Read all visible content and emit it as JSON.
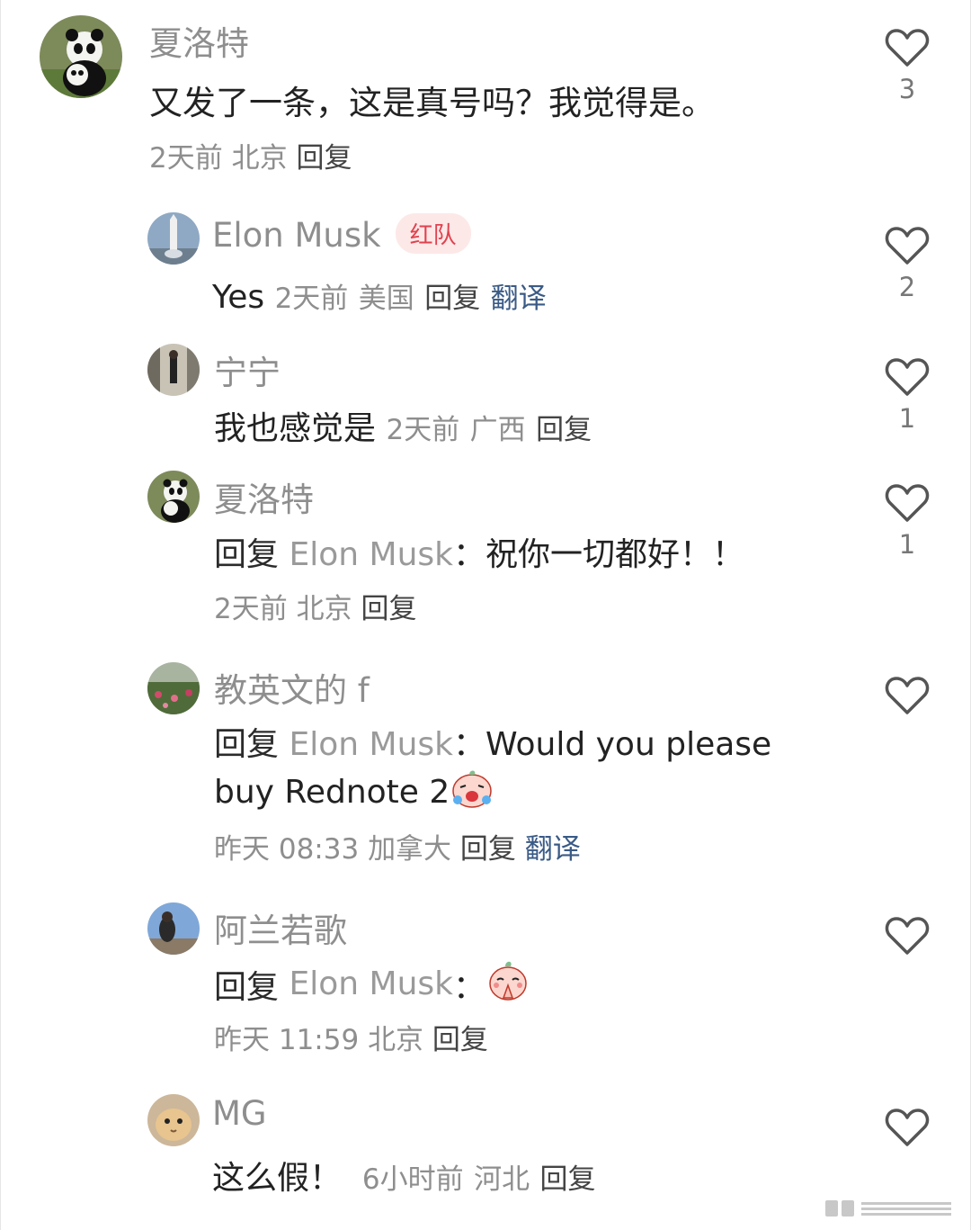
{
  "comments": [
    {
      "user": "夏洛特",
      "text": "又发了一条，这是真号吗？我觉得是。",
      "time": "2天前",
      "location": "北京",
      "reply_label": "回复",
      "likes": "3",
      "avatar_icon": "panda-avatar-icon"
    },
    {
      "user": "Elon Musk",
      "badge": "红队",
      "text": "Yes",
      "time": "2天前",
      "location": "美国",
      "reply_label": "回复",
      "translate_label": "翻译",
      "likes": "2",
      "avatar_icon": "rocket-avatar-icon"
    },
    {
      "user": "宁宁",
      "text": "我也感觉是",
      "time": "2天前",
      "location": "广西",
      "reply_label": "回复",
      "likes": "1",
      "avatar_icon": "photo-avatar-icon"
    },
    {
      "user": "夏洛特",
      "reply_prefix": "回复",
      "reply_target": "Elon Musk",
      "colon": "：",
      "text": "祝你一切都好！！",
      "time": "2天前",
      "location": "北京",
      "reply_label": "回复",
      "likes": "1",
      "avatar_icon": "panda-avatar-icon"
    },
    {
      "user": "教英文的 f",
      "reply_prefix": "回复",
      "reply_target": "Elon Musk",
      "colon": "：",
      "text": "Would you please",
      "text2": "buy Rednote 2",
      "emoji": "crying-emoji-icon",
      "time": "昨天 08:33",
      "location": "加拿大",
      "reply_label": "回复",
      "translate_label": "翻译",
      "likes": "",
      "avatar_icon": "garden-avatar-icon"
    },
    {
      "user": "阿兰若歌",
      "reply_prefix": "回复",
      "reply_target": "Elon Musk",
      "colon": "：",
      "emoji": "praying-emoji-icon",
      "time": "昨天 11:59",
      "location": "北京",
      "reply_label": "回复",
      "likes": "",
      "avatar_icon": "sky-avatar-icon"
    },
    {
      "user": "MG",
      "text": "这么假！",
      "time": "6小时前",
      "location": "河北",
      "reply_label": "回复",
      "likes": "",
      "avatar_icon": "cat-avatar-icon"
    }
  ],
  "colors": {
    "name": "#8e8e8e",
    "text": "#222222",
    "translate": "#3a5a86",
    "badge_bg": "#fde8e8",
    "badge_fg": "#e0424f"
  }
}
